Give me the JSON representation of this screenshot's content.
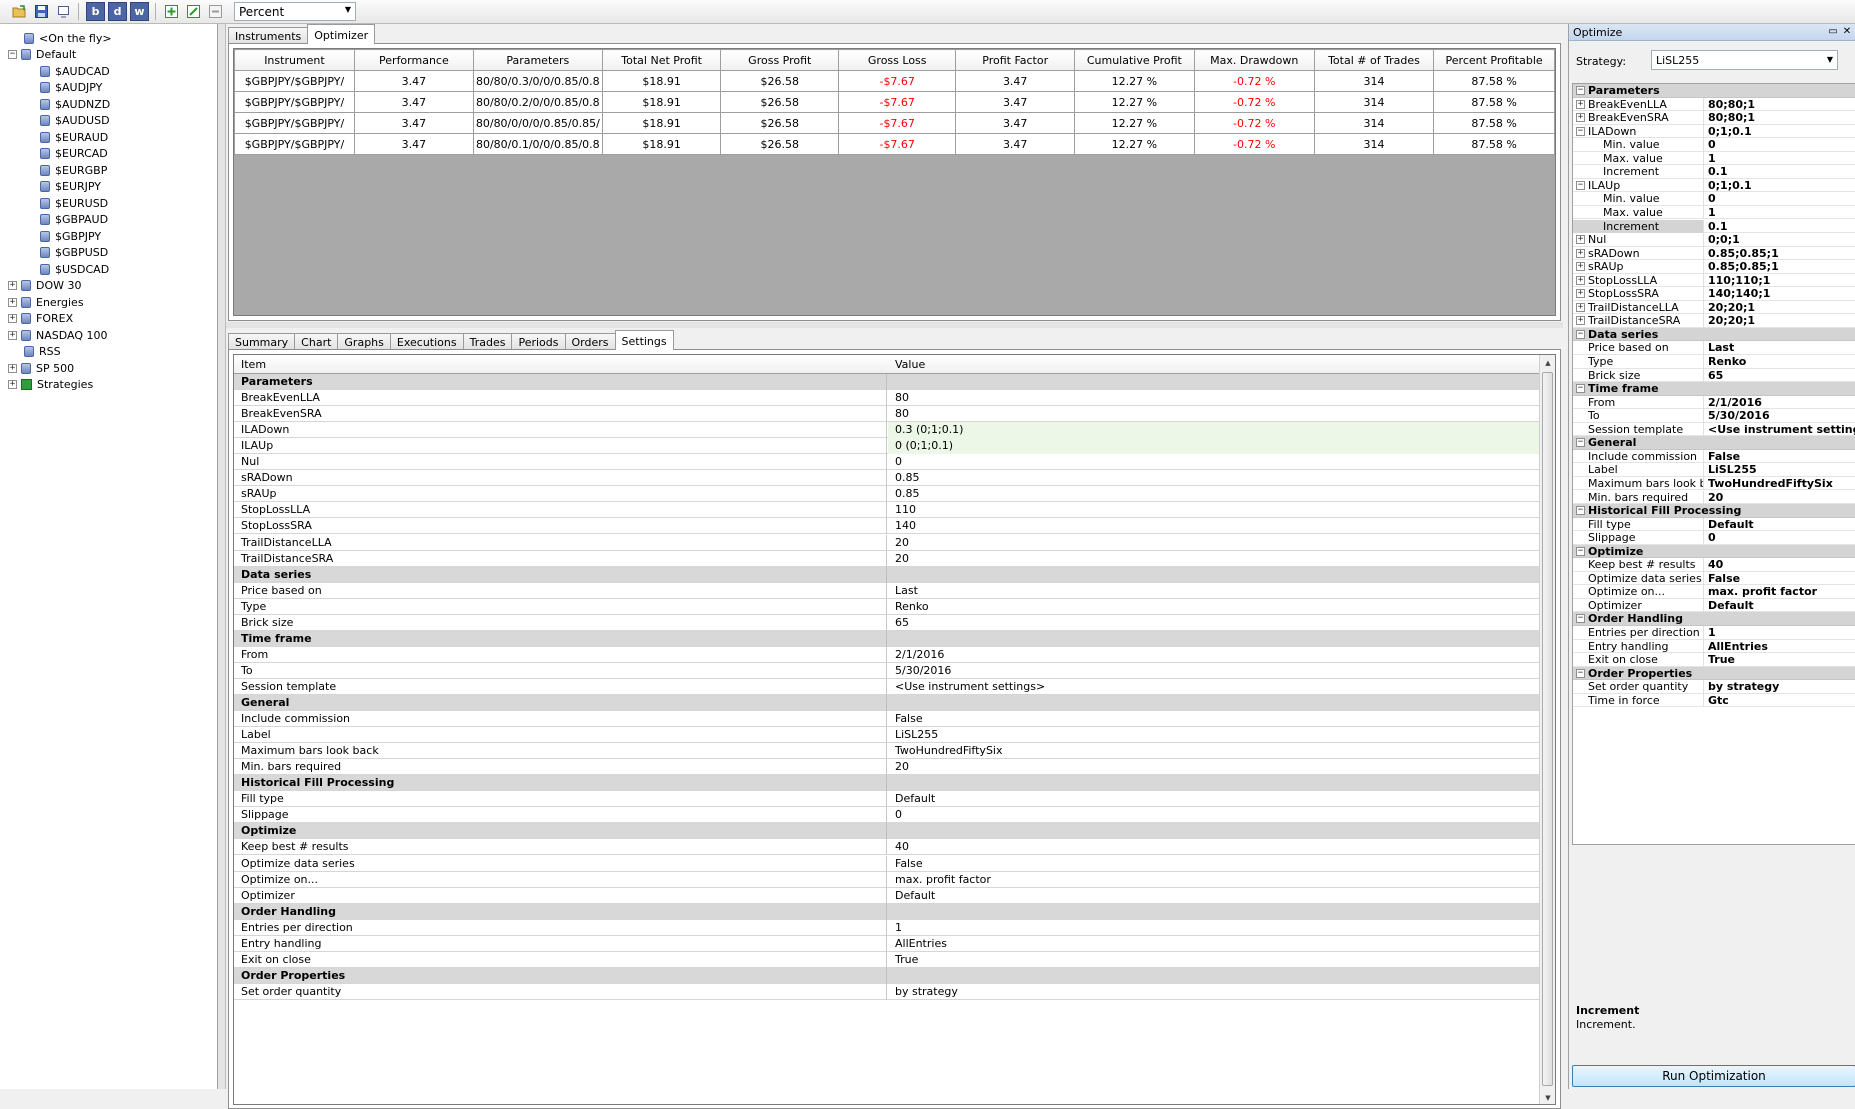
{
  "toolbar": {
    "buttons": [
      "open-icon",
      "save-icon",
      "export-icon",
      "b-icon",
      "d-icon",
      "w-icon",
      "add-icon",
      "edit-icon",
      "delete-icon"
    ],
    "b_label": "b",
    "d_label": "d",
    "w_label": "w",
    "mode_select": "Percent"
  },
  "tree": {
    "items": [
      {
        "label": "<On the fly>",
        "level": 1,
        "expander": ""
      },
      {
        "label": "Default",
        "level": 0,
        "expander": "−"
      },
      {
        "label": "$AUDCAD",
        "level": 2,
        "expander": ""
      },
      {
        "label": "$AUDJPY",
        "level": 2,
        "expander": ""
      },
      {
        "label": "$AUDNZD",
        "level": 2,
        "expander": ""
      },
      {
        "label": "$AUDUSD",
        "level": 2,
        "expander": ""
      },
      {
        "label": "$EURAUD",
        "level": 2,
        "expander": ""
      },
      {
        "label": "$EURCAD",
        "level": 2,
        "expander": ""
      },
      {
        "label": "$EURGBP",
        "level": 2,
        "expander": ""
      },
      {
        "label": "$EURJPY",
        "level": 2,
        "expander": ""
      },
      {
        "label": "$EURUSD",
        "level": 2,
        "expander": ""
      },
      {
        "label": "$GBPAUD",
        "level": 2,
        "expander": ""
      },
      {
        "label": "$GBPJPY",
        "level": 2,
        "expander": ""
      },
      {
        "label": "$GBPUSD",
        "level": 2,
        "expander": ""
      },
      {
        "label": "$USDCAD",
        "level": 2,
        "expander": ""
      },
      {
        "label": "DOW 30",
        "level": 0,
        "expander": "+"
      },
      {
        "label": "Energies",
        "level": 0,
        "expander": "+"
      },
      {
        "label": "FOREX",
        "level": 0,
        "expander": "+"
      },
      {
        "label": "NASDAQ 100",
        "level": 0,
        "expander": "+"
      },
      {
        "label": "RSS",
        "level": 1,
        "expander": ""
      },
      {
        "label": "SP 500",
        "level": 0,
        "expander": "+"
      },
      {
        "label": "Strategies",
        "level": 0,
        "expander": "+",
        "strategy": true
      }
    ]
  },
  "top_tabs": [
    "Instruments",
    "Optimizer"
  ],
  "optimizer_table": {
    "columns": [
      "Instrument",
      "Performance",
      "Parameters",
      "Total Net Profit",
      "Gross Profit",
      "Gross Loss",
      "Profit Factor",
      "Cumulative Profit",
      "Max. Drawdown",
      "Total # of Trades",
      "Percent Profitable"
    ],
    "rows": [
      [
        "$GBPJPY/$GBPJPY/",
        "3.47",
        "80/80/0.3/0/0/0.85/0.8",
        "$18.91",
        "$26.58",
        "-$7.67",
        "3.47",
        "12.27 %",
        "-0.72 %",
        "314",
        "87.58 %"
      ],
      [
        "$GBPJPY/$GBPJPY/",
        "3.47",
        "80/80/0.2/0/0/0.85/0.8",
        "$18.91",
        "$26.58",
        "-$7.67",
        "3.47",
        "12.27 %",
        "-0.72 %",
        "314",
        "87.58 %"
      ],
      [
        "$GBPJPY/$GBPJPY/",
        "3.47",
        "80/80/0/0/0/0.85/0.85/",
        "$18.91",
        "$26.58",
        "-$7.67",
        "3.47",
        "12.27 %",
        "-0.72 %",
        "314",
        "87.58 %"
      ],
      [
        "$GBPJPY/$GBPJPY/",
        "3.47",
        "80/80/0.1/0/0/0.85/0.8",
        "$18.91",
        "$26.58",
        "-$7.67",
        "3.47",
        "12.27 %",
        "-0.72 %",
        "314",
        "87.58 %"
      ]
    ]
  },
  "bottom_tabs": [
    "Summary",
    "Chart",
    "Graphs",
    "Executions",
    "Trades",
    "Periods",
    "Orders",
    "Settings"
  ],
  "settings_grid": {
    "header_item": "Item",
    "header_value": "Value",
    "rows": [
      {
        "k": "Parameters",
        "v": "",
        "cat": true
      },
      {
        "k": "BreakEvenLLA",
        "v": "80"
      },
      {
        "k": "BreakEvenSRA",
        "v": "80"
      },
      {
        "k": "ILADown",
        "v": "0.3 (0;1;0.1)",
        "hl": true
      },
      {
        "k": "ILAUp",
        "v": "0 (0;1;0.1)",
        "hl": true
      },
      {
        "k": "Nul",
        "v": "0"
      },
      {
        "k": "sRADown",
        "v": "0.85"
      },
      {
        "k": "sRAUp",
        "v": "0.85"
      },
      {
        "k": "StopLossLLA",
        "v": "110"
      },
      {
        "k": "StopLossSRA",
        "v": "140"
      },
      {
        "k": "TrailDistanceLLA",
        "v": "20"
      },
      {
        "k": "TrailDistanceSRA",
        "v": "20"
      },
      {
        "k": "Data series",
        "v": "",
        "cat": true
      },
      {
        "k": "Price based on",
        "v": "Last"
      },
      {
        "k": "Type",
        "v": "Renko"
      },
      {
        "k": "Brick size",
        "v": "65"
      },
      {
        "k": "Time frame",
        "v": "",
        "cat": true
      },
      {
        "k": "From",
        "v": "2/1/2016"
      },
      {
        "k": "To",
        "v": "5/30/2016"
      },
      {
        "k": "Session template",
        "v": "<Use instrument settings>"
      },
      {
        "k": "General",
        "v": "",
        "cat": true
      },
      {
        "k": "Include commission",
        "v": "False"
      },
      {
        "k": "Label",
        "v": "LiSL255"
      },
      {
        "k": "Maximum bars look back",
        "v": "TwoHundredFiftySix"
      },
      {
        "k": "Min. bars required",
        "v": "20"
      },
      {
        "k": "Historical Fill Processing",
        "v": "",
        "cat": true
      },
      {
        "k": "Fill type",
        "v": "Default"
      },
      {
        "k": "Slippage",
        "v": "0"
      },
      {
        "k": "Optimize",
        "v": "",
        "cat": true
      },
      {
        "k": "Keep best # results",
        "v": "40"
      },
      {
        "k": "Optimize data series",
        "v": "False"
      },
      {
        "k": "Optimize on...",
        "v": "max. profit factor"
      },
      {
        "k": "Optimizer",
        "v": "Default"
      },
      {
        "k": "Order Handling",
        "v": "",
        "cat": true
      },
      {
        "k": "Entries per direction",
        "v": "1"
      },
      {
        "k": "Entry handling",
        "v": "AllEntries"
      },
      {
        "k": "Exit on close",
        "v": "True"
      },
      {
        "k": "Order Properties",
        "v": "",
        "cat": true
      },
      {
        "k": "Set order quantity",
        "v": "by strategy"
      }
    ]
  },
  "optimize_panel": {
    "title": "Optimize",
    "strategy_label": "Strategy:",
    "strategy_value": "LiSL255",
    "rows": [
      {
        "k": "Parameters",
        "cat": true
      },
      {
        "k": "BreakEvenLLA",
        "v": "80;80;1",
        "exp": "+"
      },
      {
        "k": "BreakEvenSRA",
        "v": "80;80;1",
        "exp": "+"
      },
      {
        "k": "ILADown",
        "v": "0;1;0.1",
        "exp": "−"
      },
      {
        "k": "Min. value",
        "v": "0",
        "sub": true
      },
      {
        "k": "Max. value",
        "v": "1",
        "sub": true
      },
      {
        "k": "Increment",
        "v": "0.1",
        "sub": true
      },
      {
        "k": "ILAUp",
        "v": "0;1;0.1",
        "exp": "−"
      },
      {
        "k": "Min. value",
        "v": "0",
        "sub": true
      },
      {
        "k": "Max. value",
        "v": "1",
        "sub": true
      },
      {
        "k": "Increment",
        "v": "0.1",
        "sub": true,
        "sel": true
      },
      {
        "k": "Nul",
        "v": "0;0;1",
        "exp": "+"
      },
      {
        "k": "sRADown",
        "v": "0.85;0.85;1",
        "exp": "+"
      },
      {
        "k": "sRAUp",
        "v": "0.85;0.85;1",
        "exp": "+"
      },
      {
        "k": "StopLossLLA",
        "v": "110;110;1",
        "exp": "+"
      },
      {
        "k": "StopLossSRA",
        "v": "140;140;1",
        "exp": "+"
      },
      {
        "k": "TrailDistanceLLA",
        "v": "20;20;1",
        "exp": "+"
      },
      {
        "k": "TrailDistanceSRA",
        "v": "20;20;1",
        "exp": "+"
      },
      {
        "k": "Data series",
        "cat": true
      },
      {
        "k": "Price based on",
        "v": "Last"
      },
      {
        "k": "Type",
        "v": "Renko"
      },
      {
        "k": "Brick size",
        "v": "65"
      },
      {
        "k": "Time frame",
        "cat": true
      },
      {
        "k": "From",
        "v": "2/1/2016"
      },
      {
        "k": "To",
        "v": "5/30/2016"
      },
      {
        "k": "Session template",
        "v": "<Use instrument settings>"
      },
      {
        "k": "General",
        "cat": true
      },
      {
        "k": "Include commission",
        "v": "False"
      },
      {
        "k": "Label",
        "v": "LiSL255"
      },
      {
        "k": "Maximum bars look bac",
        "v": "TwoHundredFiftySix"
      },
      {
        "k": "Min. bars required",
        "v": "20"
      },
      {
        "k": "Historical Fill Processing",
        "cat": true
      },
      {
        "k": "Fill type",
        "v": "Default"
      },
      {
        "k": "Slippage",
        "v": "0"
      },
      {
        "k": "Optimize",
        "cat": true
      },
      {
        "k": "Keep best # results",
        "v": "40"
      },
      {
        "k": "Optimize data series",
        "v": "False"
      },
      {
        "k": "Optimize on...",
        "v": "max. profit factor"
      },
      {
        "k": "Optimizer",
        "v": "Default"
      },
      {
        "k": "Order Handling",
        "cat": true
      },
      {
        "k": "Entries per direction",
        "v": "1"
      },
      {
        "k": "Entry handling",
        "v": "AllEntries"
      },
      {
        "k": "Exit on close",
        "v": "True"
      },
      {
        "k": "Order Properties",
        "cat": true
      },
      {
        "k": "Set order quantity",
        "v": "by strategy"
      },
      {
        "k": "Time in force",
        "v": "Gtc"
      }
    ],
    "desc_title": "Increment",
    "desc_text": "Increment.",
    "run_button": "Run Optimization"
  },
  "colors": {
    "negative": "#ff0000",
    "category_bg": "#d8d8d8",
    "highlight_bg": "#ecf7e7"
  }
}
